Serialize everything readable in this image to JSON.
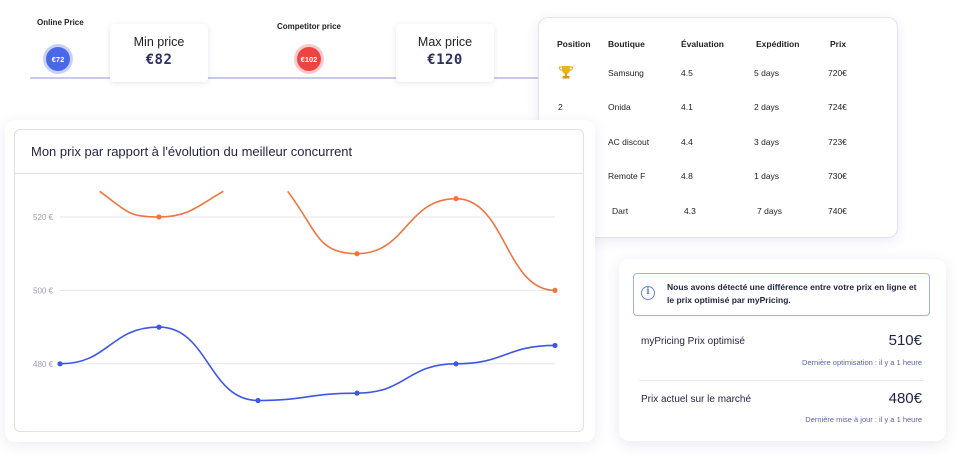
{
  "price_strip": {
    "online_label": "Online Price",
    "online_value": "€72",
    "min_title": "Min price",
    "min_value": "€82",
    "competitor_label": "Competitor price",
    "competitor_value": "€102",
    "max_title": "Max price",
    "max_value": "€120",
    "colors": {
      "online": "#4a67e8",
      "competitor": "#ee4343"
    }
  },
  "table": {
    "headers": [
      "Position",
      "Boutique",
      "Évaluation",
      "Expédition",
      "Prix"
    ],
    "rows": [
      {
        "position_icon": "trophy-icon",
        "position": "",
        "boutique": "Samsung",
        "evaluation": "4.5",
        "expedition": "5 days",
        "prix": "720€"
      },
      {
        "position": "2",
        "boutique": "Onida",
        "evaluation": "4.1",
        "expedition": "2 days",
        "prix": "724€"
      },
      {
        "position": "",
        "boutique": "AC discout",
        "evaluation": "4.4",
        "expedition": "3 days",
        "prix": "723€"
      },
      {
        "position": "",
        "boutique": "Remote F",
        "evaluation": "4.8",
        "expedition": "1 days",
        "prix": "730€"
      },
      {
        "position": "",
        "boutique": "Dart",
        "evaluation": "4.3",
        "expedition": "7 days",
        "prix": "740€"
      }
    ]
  },
  "chart": {
    "title": "Mon prix par rapport à l'évolution du meilleur concurrent"
  },
  "chart_data": {
    "type": "line",
    "title": "Mon prix par rapport à l'évolution du meilleur concurrent",
    "ylim": [
      470,
      530
    ],
    "yticks": [
      "520 €",
      "500 €",
      "480 €"
    ],
    "ytick_values": [
      520,
      500,
      480
    ],
    "grid": true,
    "series": [
      {
        "color": "#f0743e",
        "points": [
          [
            1,
            520
          ],
          [
            3,
            510
          ],
          [
            4,
            525
          ],
          [
            5,
            500
          ]
        ],
        "curve_left_edge": [
          0.4,
          527
        ],
        "curve_mid_start": [
          2.3,
          527
        ]
      },
      {
        "color": "#3d56e8",
        "points": [
          [
            0,
            480
          ],
          [
            1,
            490
          ],
          [
            2,
            470
          ],
          [
            3,
            472
          ],
          [
            4,
            480
          ],
          [
            5,
            485
          ]
        ]
      }
    ]
  },
  "info": {
    "alert_text": "Nous avons détecté une différence entre votre prix en ligne et le prix optimisé par myPricing.",
    "row1_label": "myPricing Prix optimisé",
    "row1_value": "510€",
    "row1_sub": "Dernière optimisation : il y a 1 heure",
    "row2_label": "Prix actuel sur le marché",
    "row2_value": "480€",
    "row2_sub": "Dernière mise à jour : il y a 1 heure"
  }
}
